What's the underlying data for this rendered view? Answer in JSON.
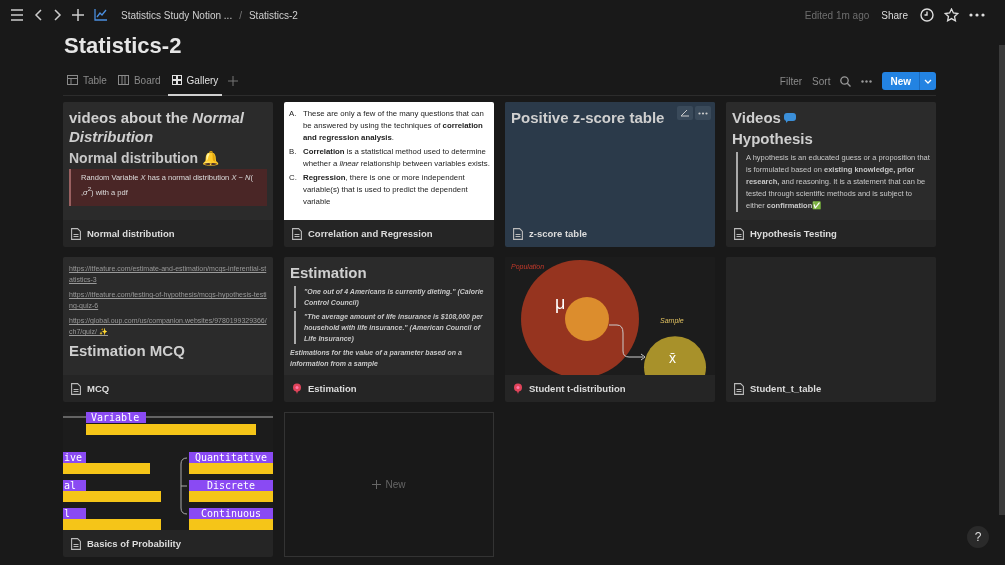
{
  "topbar": {
    "breadcrumb": [
      "Statistics Study Notion ...",
      "Statistics-2"
    ],
    "separator": "/",
    "edited": "Edited 1m ago",
    "share": "Share"
  },
  "title": "Statistics-2",
  "views": [
    {
      "label": "Table",
      "kind": "table",
      "selected": false
    },
    {
      "label": "Board",
      "kind": "board",
      "selected": false
    },
    {
      "label": "Gallery",
      "kind": "gallery",
      "selected": true
    }
  ],
  "toolbar": {
    "filter": "Filter",
    "sort": "Sort",
    "new": "New"
  },
  "cards": [
    {
      "title": "Normal distribution",
      "kind": "page",
      "hovered": false,
      "preview": {
        "kind": "blocks",
        "blocks": [
          {
            "kind": "h1",
            "text": "videos about the *Normal Distribution*"
          },
          {
            "kind": "h2",
            "text": "Normal distribution 🔔"
          },
          {
            "kind": "callout",
            "text": "Random Variable *X* has a normal distribution *X* − *N*( ,*σ*$^{2}$) with a pdf"
          }
        ]
      }
    },
    {
      "title": "Correlation and Regression",
      "kind": "page",
      "hovered": false,
      "preview": {
        "kind": "document",
        "blocks": [
          {
            "marker": "A.",
            "text": "These are only a few of the many questions that can be answered by using the techniques of **correlation and regression analysis**."
          },
          {
            "marker": "B.",
            "text": "**Correlation** is a statistical method used to determine whether a *linear* relationship between variables exists."
          },
          {
            "marker": "C.",
            "text": "**Regression**, there is one or more independent variable(s) that is used to predict the dependent variable"
          }
        ]
      }
    },
    {
      "title": "z-score table",
      "kind": "page",
      "hovered": true,
      "preview": {
        "kind": "blocks",
        "blocks": [
          {
            "kind": "h1",
            "text": "Positive z-score table"
          }
        ]
      }
    },
    {
      "title": "Hypothesis Testing",
      "kind": "page",
      "hovered": false,
      "preview": {
        "kind": "blocks",
        "blocks": [
          {
            "kind": "h1-chat",
            "text": "Videos"
          },
          {
            "kind": "h1",
            "text": "Hypothesis"
          },
          {
            "kind": "quote",
            "text": "A hypothesis is an educated guess or a proposition that is formulated based on **existing knowledge, prior research,** and reasoning. It is a statement that can be tested through scientific methods and is subject to either **confirmation**✅"
          }
        ]
      }
    },
    {
      "title": "MCQ",
      "kind": "page",
      "hovered": false,
      "preview": {
        "kind": "blocks",
        "blocks": [
          {
            "kind": "link",
            "text": "https://itfeature.com/estimate-and-estimation/mcqs-inferential-statistics-3"
          },
          {
            "kind": "link",
            "text": "https://itfeature.com/testing-of-hypothesis/mcqs-hypothesis-testing-quiz-6"
          },
          {
            "kind": "link",
            "text": "https://global.oup.com/us/companion.websites/9780199329366/ch7/quiz/ ✨"
          },
          {
            "kind": "h1",
            "text": "Estimation MCQ"
          }
        ]
      }
    },
    {
      "title": "Estimation",
      "kind": "pinned",
      "hovered": false,
      "preview": {
        "kind": "blocks",
        "blocks": [
          {
            "kind": "h1",
            "text": "Estimation"
          },
          {
            "kind": "quote-italic",
            "text": "\"One out of 4 Americans is currently dieting.\" (Calorie Control Council)"
          },
          {
            "kind": "quote-italic",
            "text": "\"The average amount of life insurance is $108,000 per household with life insurance.\" (American Council of Life Insurance)"
          },
          {
            "kind": "para-italic",
            "text": "Estimations for the value of a parameter based on a information from a sample"
          }
        ]
      }
    },
    {
      "title": "Student t-distribution",
      "kind": "pinned",
      "hovered": false,
      "preview": {
        "kind": "population-drawing",
        "labels": [
          "Population",
          "μ",
          "Sample",
          "x̄"
        ]
      }
    },
    {
      "title": "Student_t_table",
      "kind": "page",
      "hovered": false,
      "preview": {
        "kind": "empty"
      }
    },
    {
      "title": "Basics of Probability",
      "kind": "page",
      "hovered": false,
      "preview": {
        "kind": "variable-drawing",
        "labels": [
          "Variable",
          "ive",
          "al",
          "l",
          "Quantitative",
          "Discrete",
          "Continuous"
        ]
      }
    }
  ],
  "new_card": "New",
  "help": "?"
}
